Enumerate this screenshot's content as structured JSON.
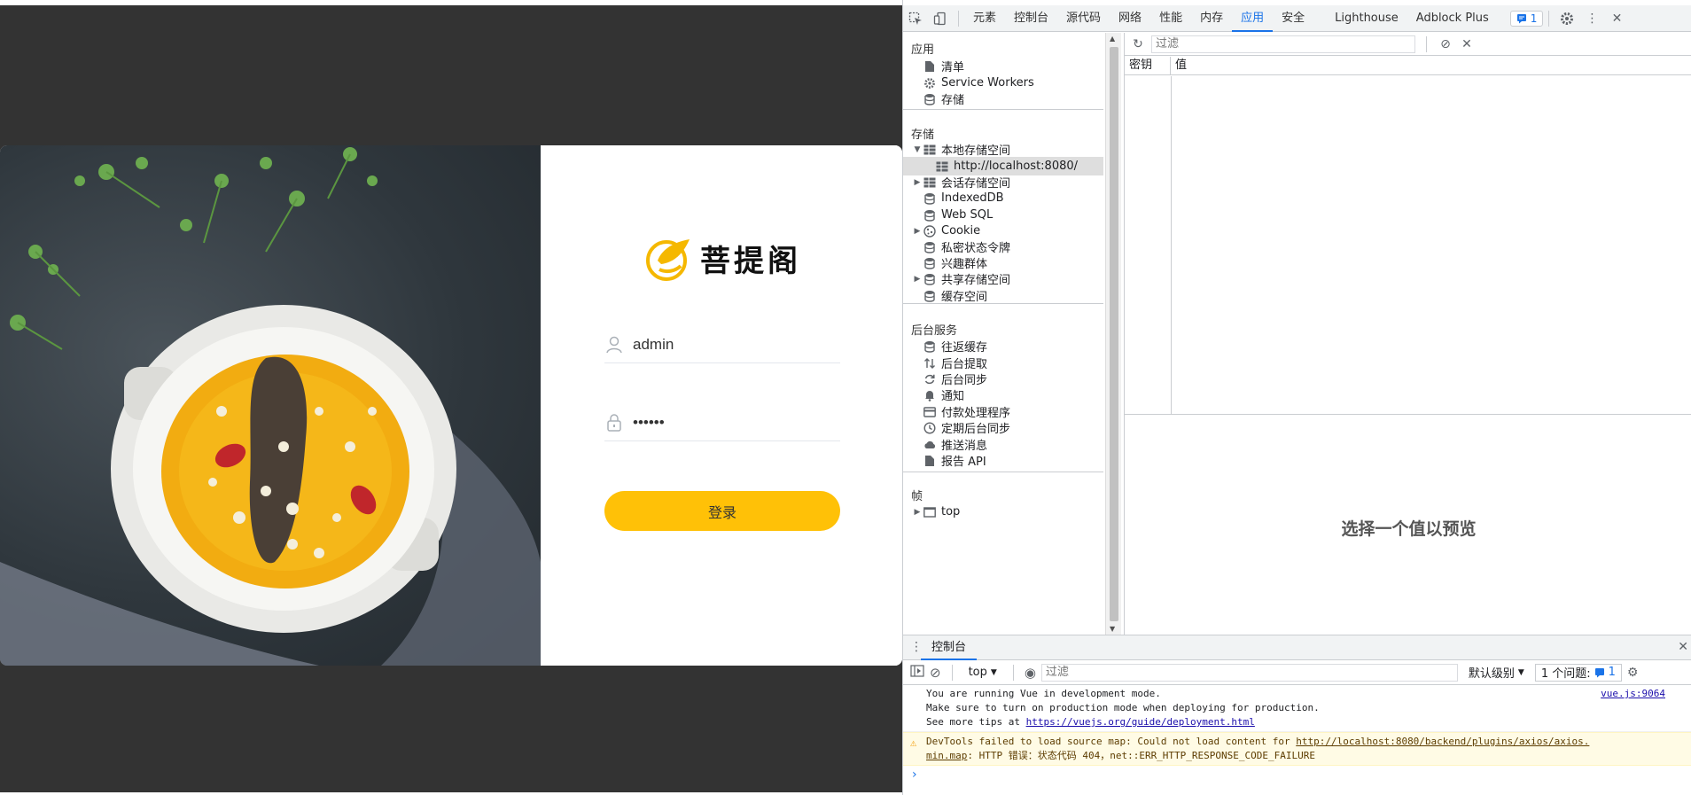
{
  "login": {
    "brand": "菩提阁",
    "username_value": "admin",
    "password_value": "••••••",
    "login_button": "登录"
  },
  "devtools": {
    "tabs": [
      "元素",
      "控制台",
      "源代码",
      "网络",
      "性能",
      "内存",
      "应用",
      "安全",
      "Lighthouse",
      "Adblock Plus"
    ],
    "active_tab": "应用",
    "issues_badge": "1",
    "sidebar": {
      "sections": [
        {
          "title": "应用",
          "items": [
            {
              "label": "清单",
              "icon": "file-icon"
            },
            {
              "label": "Service Workers",
              "icon": "gear-icon"
            },
            {
              "label": "存储",
              "icon": "database-icon"
            }
          ]
        },
        {
          "title": "存储",
          "items": [
            {
              "label": "本地存储空间",
              "icon": "grid-icon",
              "expandable": true,
              "expanded": true
            },
            {
              "label": "http://localhost:8080/",
              "icon": "grid-icon",
              "child": true,
              "selected": true
            },
            {
              "label": "会话存储空间",
              "icon": "grid-icon",
              "expandable": true
            },
            {
              "label": "IndexedDB",
              "icon": "database-icon"
            },
            {
              "label": "Web SQL",
              "icon": "database-icon"
            },
            {
              "label": "Cookie",
              "icon": "cookie-icon",
              "expandable": true
            },
            {
              "label": "私密状态令牌",
              "icon": "database-icon"
            },
            {
              "label": "兴趣群体",
              "icon": "database-icon"
            },
            {
              "label": "共享存储空间",
              "icon": "database-icon",
              "expandable": true
            },
            {
              "label": "缓存空间",
              "icon": "database-icon"
            }
          ]
        },
        {
          "title": "后台服务",
          "items": [
            {
              "label": "往返缓存",
              "icon": "database-icon"
            },
            {
              "label": "后台提取",
              "icon": "updown-arrows-icon"
            },
            {
              "label": "后台同步",
              "icon": "sync-icon"
            },
            {
              "label": "通知",
              "icon": "bell-icon"
            },
            {
              "label": "付款处理程序",
              "icon": "card-icon"
            },
            {
              "label": "定期后台同步",
              "icon": "clock-icon"
            },
            {
              "label": "推送消息",
              "icon": "cloud-icon"
            },
            {
              "label": "报告 API",
              "icon": "file-icon"
            }
          ]
        },
        {
          "title": "帧",
          "items": [
            {
              "label": "top",
              "icon": "frame-icon",
              "expandable": true
            }
          ]
        }
      ]
    },
    "storage": {
      "filter_placeholder": "过滤",
      "col_key": "密钥",
      "col_value": "值",
      "preview_message": "选择一个值以预览"
    },
    "console": {
      "tab": "控制台",
      "context": "top",
      "filter_placeholder": "过滤",
      "level": "默认级别",
      "issues_label": "1 个问题:",
      "issues_count": "1",
      "logs": {
        "info_line1": "You are running Vue in development mode.",
        "info_line2": "Make sure to turn on production mode when deploying for production.",
        "info_line3_prefix": "See more tips at ",
        "info_line3_link": "https://vuejs.org/guide/deployment.html",
        "info_source": "vue.js:9064",
        "warn_prefix": "DevTools failed to load source map: Could not load content for ",
        "warn_link1": "http://localhost:8080/backend/plugins/axios/axios.",
        "warn_link2": "min.map",
        "warn_suffix": ": HTTP 错误：状态代码 404，net::ERR_HTTP_RESPONSE_CODE_FAILURE"
      }
    }
  },
  "colors": {
    "accent_yellow": "#ffc107",
    "devtools_blue": "#1a73e8",
    "backdrop": "#333333"
  }
}
